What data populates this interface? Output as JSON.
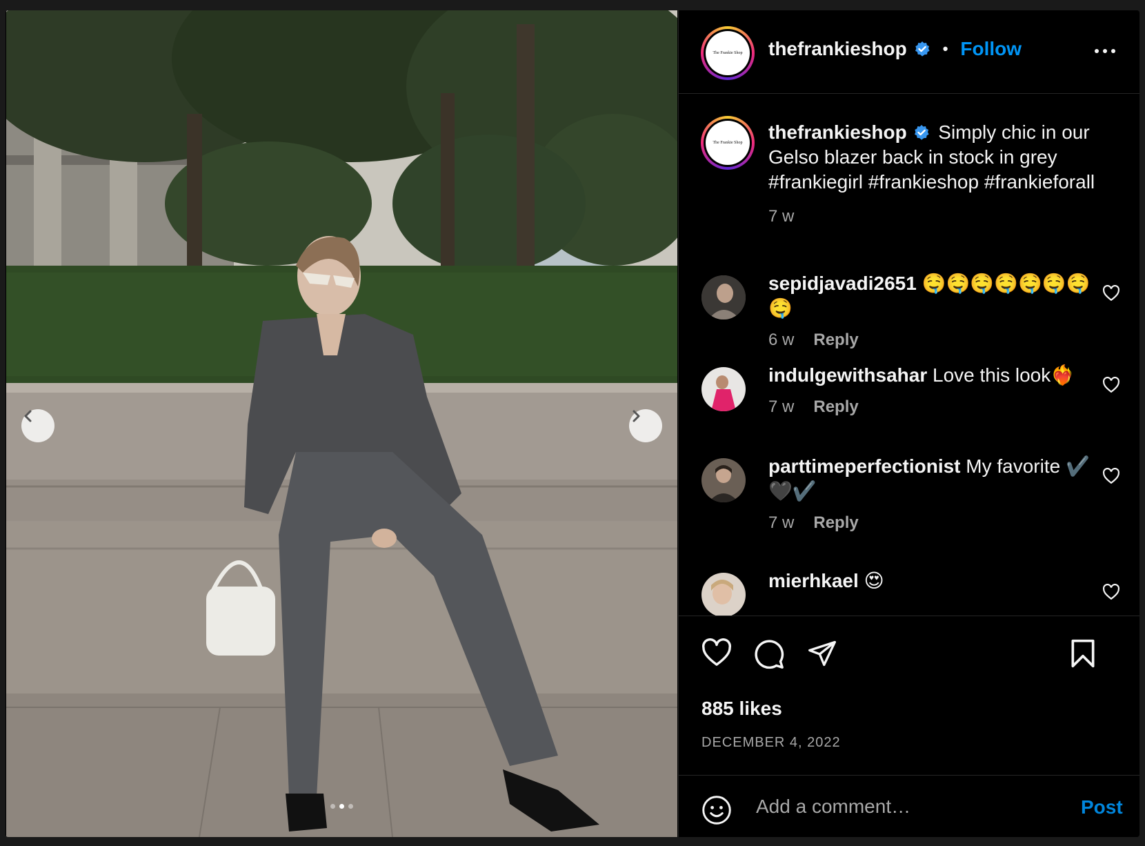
{
  "post": {
    "account": {
      "username": "thefrankieshop",
      "verified": true,
      "logo_text": "The Frankie Shop"
    },
    "header": {
      "separator": "•",
      "follow_label": "Follow",
      "more_icon": "more-options-icon"
    },
    "caption": {
      "username": "thefrankieshop",
      "text": "Simply chic in our Gelso blazer back in stock in grey #frankiegirl #frankieshop #frankieforall",
      "time": "7 w"
    },
    "comments": [
      {
        "username": "sepidjavadi2651",
        "text": "🤤🤤🤤🤤🤤🤤🤤🤤",
        "time": "6 w",
        "reply_label": "Reply"
      },
      {
        "username": "indulgewithsahar",
        "text": "Love this look❤️‍🔥",
        "time": "7 w",
        "reply_label": "Reply"
      },
      {
        "username": "parttimeperfectionist",
        "text": "My favorite ✔️🖤✔️",
        "time": "7 w",
        "reply_label": "Reply"
      },
      {
        "username": "mierhkael",
        "text": "😍",
        "time": "",
        "reply_label": ""
      }
    ],
    "likes": "885 likes",
    "date": "DECEMBER 4, 2022",
    "add_comment": {
      "placeholder": "Add a comment…",
      "post_label": "Post"
    },
    "carousel": {
      "total": 3,
      "active_index": 1
    },
    "colors": {
      "accent": "#0095f6",
      "background": "#000000",
      "muted_text": "#a8a8a8",
      "divider": "#262626"
    }
  }
}
